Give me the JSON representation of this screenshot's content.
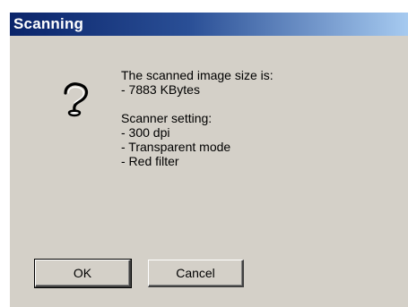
{
  "window": {
    "title": "Scanning"
  },
  "icon": {
    "name": "question-mark-icon"
  },
  "message": {
    "lines": [
      "The scanned image size is:",
      " - 7883 KBytes",
      "",
      "Scanner setting:",
      " - 300 dpi",
      " - Transparent mode",
      " - Red filter"
    ]
  },
  "buttons": {
    "ok_label": "OK",
    "cancel_label": "Cancel"
  },
  "colors": {
    "title_bar_start": "#0a246a",
    "title_bar_end": "#a6caf0",
    "dialog_face": "#d4d0c8"
  }
}
